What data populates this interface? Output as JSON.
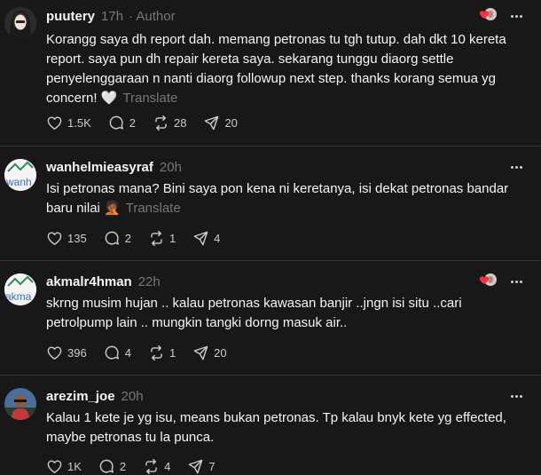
{
  "posts": [
    {
      "username": "puutery",
      "time": "17h",
      "author_label": "· Author",
      "text": "Korangg saya dh report dah. memang petronas tu tgh tutup. dah dkt 10 kereta report. saya pun dh repair kereta saya. sekarang tunggu diaorg settle penyelenggaraan n nanti diaorg followup next step. thanks korang semua yg concern! 🤍",
      "translate": "Translate",
      "likes": "1.5K",
      "replies": "2",
      "reposts": "28",
      "shares": "20"
    },
    {
      "username": "wanhelmieasyraf",
      "time": "20h",
      "avatar_text": "wanh",
      "text": "Isi petronas mana? Bini saya pon kena ni keretanya, isi dekat petronas bandar baru nilai 🤦🏾",
      "translate": "Translate",
      "likes": "135",
      "replies": "2",
      "reposts": "1",
      "shares": "4"
    },
    {
      "username": "akmalr4hman",
      "time": "22h",
      "avatar_text": "akma",
      "text": "skrng musim hujan .. kalau petronas kawasan banjir ..jngn isi situ ..cari petrolpump lain .. mungkin tangki dorng masuk air..",
      "likes": "396",
      "replies": "4",
      "reposts": "1",
      "shares": "20"
    },
    {
      "username": "arezim_joe",
      "time": "20h",
      "text": "Kalau 1 kete je yg isu, means bukan petronas. Tp kalau bnyk kete yg effected, maybe petronas tu la punca.",
      "likes": "1K",
      "replies": "2",
      "reposts": "4",
      "shares": "7"
    }
  ],
  "icons": {
    "like": "heart-icon",
    "reply": "comment-icon",
    "repost": "repost-icon",
    "share": "send-icon",
    "more": "more-icon"
  },
  "colors": {
    "background": "#181818",
    "text": "#f3f5f7",
    "muted": "#777777",
    "divider": "#323232",
    "liked_heart": "#ff3040"
  }
}
